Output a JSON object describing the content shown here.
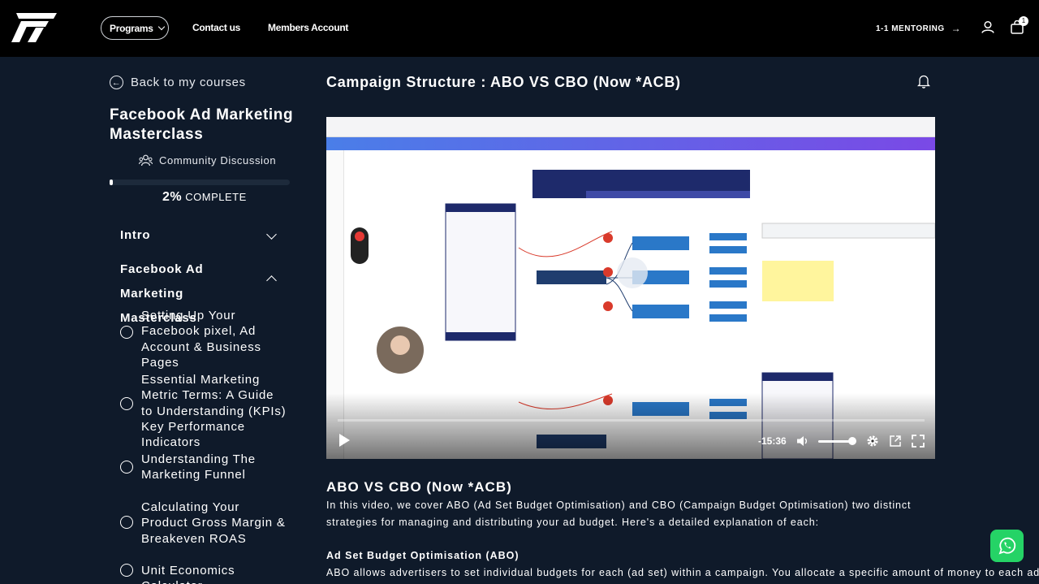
{
  "header": {
    "logo": "F",
    "programs_label": "Programs",
    "contact_label": "Contact us",
    "members_label": "Members Account",
    "mentoring_label": "1-1 MENTORING",
    "cart_count": "1"
  },
  "sidebar": {
    "back_label": "Back to my courses",
    "course_title": "Facebook Ad Marketing Masterclass",
    "community_label": "Community Discussion",
    "progress_percent": "2%",
    "progress_value": 0.02,
    "progress_suffix": "COMPLETE",
    "section_intro": "Intro",
    "section_masterclass": "Facebook Ad Marketing Masterclass",
    "lessons": [
      "Setting Up Your Facebook pixel, Ad Account & Business Pages",
      "Essential Marketing Metric Terms: A Guide to Understanding (KPIs) Key Performance Indicators",
      "Understanding The Marketing Funnel",
      "Calculating Your Product Gross Margin & Breakeven ROAS",
      "Unit Economics Calculator"
    ]
  },
  "main": {
    "page_title": "Campaign Structure : ABO VS CBO (Now *ACB)",
    "video_time": "-15:36",
    "section_heading": "ABO VS CBO (Now *ACB)",
    "intro_paragraph": "In this video, we cover ABO (Ad Set Budget Optimisation) and CBO (Campaign Budget Optimisation) two distinct strategies for managing and distributing your ad budget. Here's a detailed explanation of each:",
    "subheading": "Ad Set Budget Optimisation (ABO)",
    "abo_paragraph": "ABO allows advertisers to set individual budgets for each (ad set) within a campaign. You allocate a specific amount of money to each ad"
  },
  "colors": {
    "background": "#0f1a2a",
    "topbar": "#000000",
    "whatsapp": "#25d366"
  }
}
